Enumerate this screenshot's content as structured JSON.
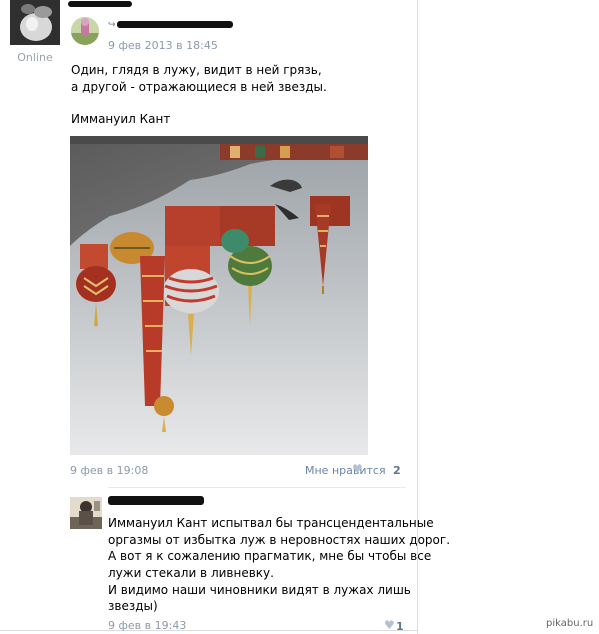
{
  "profile": {
    "status": "Online"
  },
  "post": {
    "repost_icon": "repost-arrow-icon",
    "date": "9 фев 2013 в 18:45",
    "text_lines": [
      "Один, глядя в лужу, видит в ней грязь,",
      "а другой - отражающиеся в ней звезды."
    ],
    "author_signature": "Иммануил Кант",
    "photo_icon": "puddle-reflection-cathedral-photo",
    "footer_date": "9 фев в 19:08",
    "like_label": "Мне нравится",
    "like_icon": "heart-icon",
    "like_count": "2"
  },
  "comment": {
    "lines": [
      "Иммануил Кант испытвал бы трансцендентальные",
      "оргазмы от избытка луж в неровностях наших дорог.",
      "А вот я к сожалению прагматик, мне бы чтобы все",
      "лужи стекали в ливневку.",
      "И видимо наши чиновники видят в лужах лишь",
      "звезды)"
    ],
    "date": "9 фев в 19:43",
    "like_count": "1"
  },
  "watermark": "pikabu.ru"
}
